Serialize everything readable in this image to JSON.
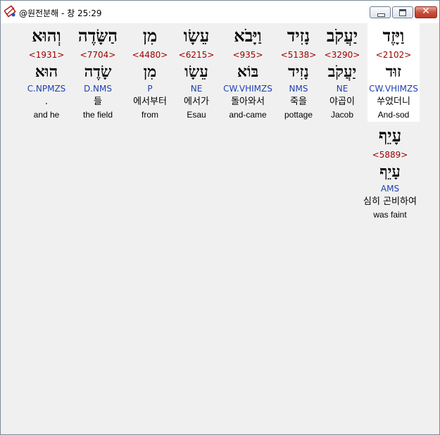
{
  "window": {
    "title": "@원전분해 - 창 25:29",
    "close_label": "✕"
  },
  "words": [
    {
      "heb": "וַיָּזֶד",
      "strong": "<2102>",
      "lemma": "זוּד",
      "parse": "CW.VHIMZS",
      "kor": "쑤었더니",
      "eng": "And-sod"
    },
    {
      "heb": "יַעֲקֹב",
      "strong": "<3290>",
      "lemma": "יַעֲקֹב",
      "parse": "NE",
      "kor": "야곱이",
      "eng": "Jacob"
    },
    {
      "heb": "נָזִיד",
      "strong": "<5138>",
      "lemma": "נָזִיד",
      "parse": "NMS",
      "kor": "죽을",
      "eng": "pottage"
    },
    {
      "heb": "וַיָּבֹא",
      "strong": "<935>",
      "lemma": "בּוֹא",
      "parse": "CW.VHIMZS",
      "kor": "돌아와서",
      "eng": "and-came"
    },
    {
      "heb": "עֵשָׂו",
      "strong": "<6215>",
      "lemma": "עֵשָׂו",
      "parse": "NE",
      "kor": "에서가",
      "eng": "Esau"
    },
    {
      "heb": "מִן",
      "strong": "<4480>",
      "lemma": "מִן",
      "parse": "P",
      "kor": "에서부터",
      "eng": "from"
    },
    {
      "heb": "הַשָּׂדֶה",
      "strong": "<7704>",
      "lemma": "שָׂדֶה",
      "parse": "D.NMS",
      "kor": "들",
      "eng": "the field"
    },
    {
      "heb": "וְהוּא",
      "strong": "<1931>",
      "lemma": "הוּא",
      "parse": "C.NPMZS",
      "kor": ".",
      "eng": "and he"
    },
    {
      "heb": "עָיֵף",
      "strong": "<5889>",
      "lemma": "עָיֵף",
      "parse": "AMS",
      "kor": "심히 곤비하여",
      "eng": "was faint"
    }
  ]
}
